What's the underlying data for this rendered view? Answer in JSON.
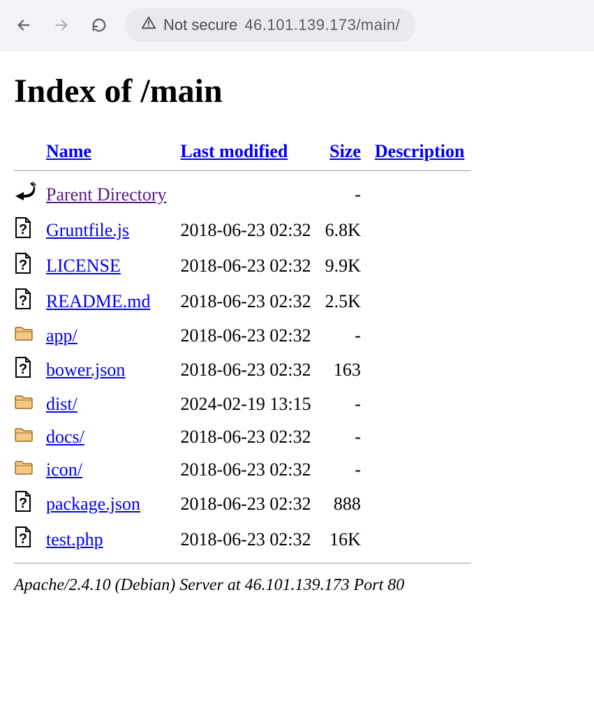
{
  "browser": {
    "not_secure_label": "Not secure",
    "url": "46.101.139.173/main/"
  },
  "page_title": "Index of /main",
  "columns": {
    "name": "Name",
    "last_modified": "Last modified",
    "size": "Size",
    "description": "Description"
  },
  "rows": [
    {
      "icon": "back",
      "name": "Parent Directory",
      "visited": true,
      "modified": "",
      "size": "-"
    },
    {
      "icon": "unknown",
      "name": "Gruntfile.js",
      "visited": false,
      "modified": "2018-06-23 02:32",
      "size": "6.8K"
    },
    {
      "icon": "unknown",
      "name": "LICENSE",
      "visited": false,
      "modified": "2018-06-23 02:32",
      "size": "9.9K"
    },
    {
      "icon": "unknown",
      "name": "README.md",
      "visited": false,
      "modified": "2018-06-23 02:32",
      "size": "2.5K"
    },
    {
      "icon": "folder",
      "name": "app/",
      "visited": false,
      "modified": "2018-06-23 02:32",
      "size": "-"
    },
    {
      "icon": "unknown",
      "name": "bower.json",
      "visited": false,
      "modified": "2018-06-23 02:32",
      "size": "163"
    },
    {
      "icon": "folder",
      "name": "dist/",
      "visited": false,
      "modified": "2024-02-19 13:15",
      "size": "-"
    },
    {
      "icon": "folder",
      "name": "docs/",
      "visited": false,
      "modified": "2018-06-23 02:32",
      "size": "-"
    },
    {
      "icon": "folder",
      "name": "icon/",
      "visited": false,
      "modified": "2018-06-23 02:32",
      "size": "-"
    },
    {
      "icon": "unknown",
      "name": "package.json",
      "visited": false,
      "modified": "2018-06-23 02:32",
      "size": "888"
    },
    {
      "icon": "unknown",
      "name": "test.php",
      "visited": false,
      "modified": "2018-06-23 02:32",
      "size": "16K"
    }
  ],
  "footer": "Apache/2.4.10 (Debian) Server at 46.101.139.173 Port 80"
}
